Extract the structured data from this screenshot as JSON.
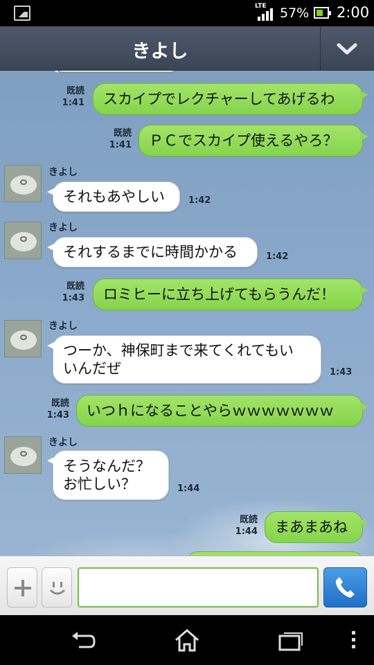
{
  "status_bar": {
    "network": "LTE",
    "battery": "57%",
    "time": "2:00"
  },
  "header": {
    "title": "きよし"
  },
  "messages": [
    {
      "side": "me",
      "text": "スカイプでレクチャーしてあげるわ",
      "read": "既読",
      "time": "1:41"
    },
    {
      "side": "me",
      "text": "ＰＣでスカイプ使えるやろ？",
      "read": "既読",
      "time": "1:41"
    },
    {
      "side": "them",
      "sender": "きよし",
      "text": "それもあやしい",
      "time": "1:42"
    },
    {
      "side": "them",
      "sender": "きよし",
      "text": "それするまでに時間かかる",
      "time": "1:42"
    },
    {
      "side": "me",
      "text": "ロミヒーに立ち上げてもらうんだ！",
      "read": "既読",
      "time": "1:43"
    },
    {
      "side": "them",
      "sender": "きよし",
      "text": "つーか、神保町まで来てくれてもい\nいんだぜ",
      "time": "1:43"
    },
    {
      "side": "me",
      "text": "いつｈになることやらｗｗｗｗｗｗｗ",
      "read": "既読",
      "time": "1:43"
    },
    {
      "side": "them",
      "sender": "きよし",
      "text": "そうなんだ？\nお忙しい？",
      "time": "1:44"
    },
    {
      "side": "me",
      "text": "まあまあね",
      "read": "既読",
      "time": "1:44"
    }
  ],
  "input": {
    "value": "",
    "placeholder": ""
  },
  "colors": {
    "my_bubble": "#8fd955",
    "their_bubble": "#ffffff",
    "header": "#434e5e",
    "call_button": "#2f84d8"
  },
  "icons": {
    "plus": "plus-icon",
    "emoji": "smiley-icon",
    "call": "phone-icon",
    "back": "back-icon",
    "home": "home-icon",
    "recent": "recent-apps-icon",
    "menu": "menu-icon"
  }
}
